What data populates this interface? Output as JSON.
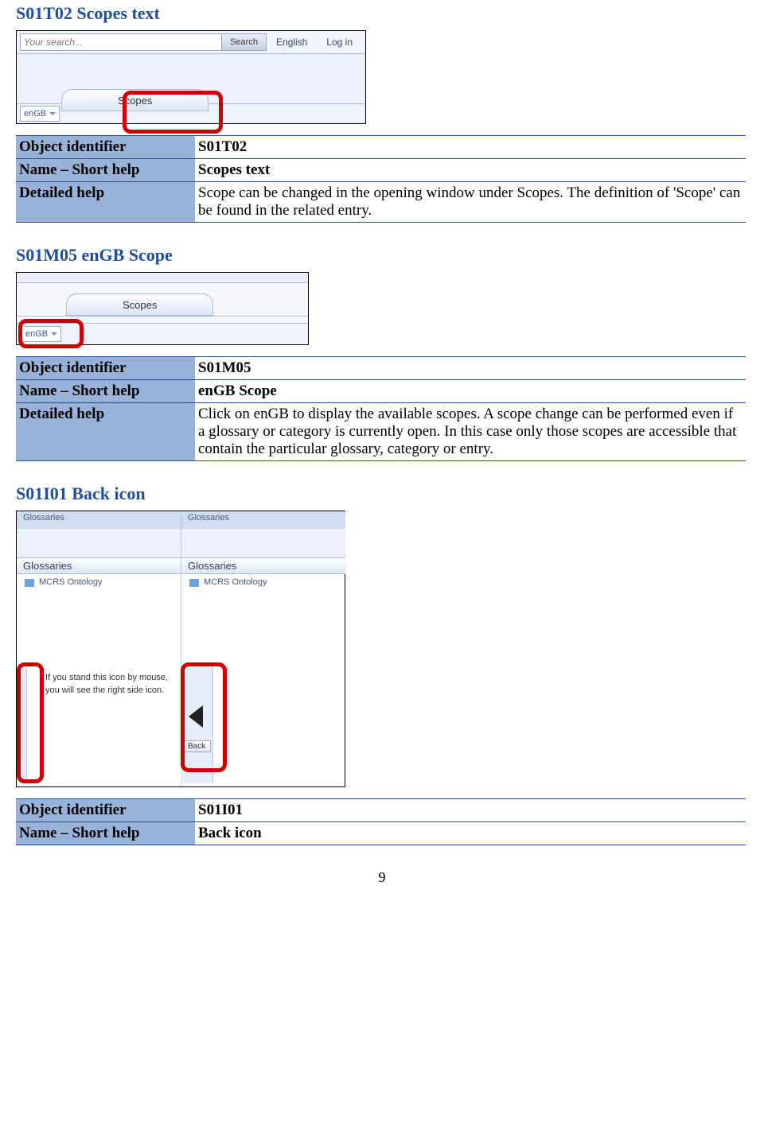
{
  "page_number": "9",
  "section1": {
    "heading": "S01T02 Scopes text",
    "object_identifier_label": "Object identifier",
    "object_identifier": "S01T02",
    "name_label": "Name – Short help",
    "name_value": "Scopes text",
    "detail_label": "Detailed help",
    "detail_value": "Scope can be changed in the opening window under Scopes. The definition of 'Scope' can be found in the related entry."
  },
  "section2": {
    "heading": "S01M05 enGB Scope",
    "object_identifier_label": "Object identifier",
    "object_identifier": "S01M05",
    "name_label": "Name – Short help",
    "name_value": "enGB Scope",
    "detail_label": "Detailed help",
    "detail_value": "Click on enGB to display the available scopes. A scope change can be performed even if a glossary or category is currently open. In this case only those scopes are accessible that contain the particular glossary, category or entry."
  },
  "section3": {
    "heading": "S01I01 Back icon",
    "object_identifier_label": "Object identifier",
    "object_identifier": "S01I01",
    "name_label": "Name – Short help",
    "name_value": "Back icon"
  },
  "shot1": {
    "search_placeholder": "Your search...",
    "search_btn": "Search",
    "lang": "English",
    "login": "Log in",
    "tab_label": "Scopes",
    "engb": "enGB"
  },
  "shot2": {
    "tab_label": "Scopes",
    "engb": "enGB"
  },
  "shot3": {
    "breadcrumb": "Glossaries",
    "group_heading": "Glossaries",
    "item": "MCRS Ontology",
    "hint": "If you stand this icon by mouse, you will see the right side icon.",
    "back_label": "Back"
  }
}
